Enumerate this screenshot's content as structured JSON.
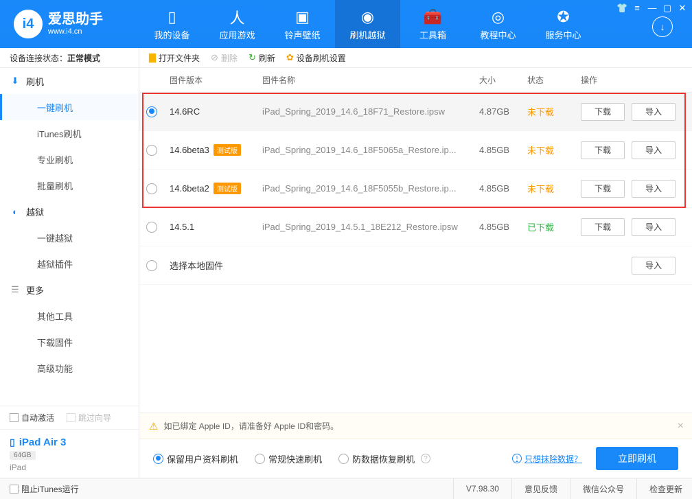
{
  "app": {
    "title": "爱思助手",
    "url": "www.i4.cn"
  },
  "nav": {
    "items": [
      {
        "label": "我的设备"
      },
      {
        "label": "应用游戏"
      },
      {
        "label": "铃声壁纸"
      },
      {
        "label": "刷机越狱"
      },
      {
        "label": "工具箱"
      },
      {
        "label": "教程中心"
      },
      {
        "label": "服务中心"
      }
    ]
  },
  "sidebar": {
    "status_label": "设备连接状态：",
    "status_value": "正常模式",
    "groups": [
      {
        "label": "刷机",
        "items": [
          {
            "label": "一键刷机"
          },
          {
            "label": "iTunes刷机"
          },
          {
            "label": "专业刷机"
          },
          {
            "label": "批量刷机"
          }
        ]
      },
      {
        "label": "越狱",
        "items": [
          {
            "label": "一键越狱"
          },
          {
            "label": "越狱插件"
          }
        ]
      },
      {
        "label": "更多",
        "items": [
          {
            "label": "其他工具"
          },
          {
            "label": "下载固件"
          },
          {
            "label": "高级功能"
          }
        ]
      }
    ],
    "auto_activate": "自动激活",
    "skip_guide": "跳过向导"
  },
  "device": {
    "name": "iPad Air 3",
    "storage": "64GB",
    "type": "iPad"
  },
  "toolbar": {
    "open_folder": "打开文件夹",
    "delete": "删除",
    "refresh": "刷新",
    "settings": "设备刷机设置"
  },
  "table": {
    "headers": {
      "version": "固件版本",
      "name": "固件名称",
      "size": "大小",
      "status": "状态",
      "ops": "操作"
    },
    "status_notdl": "未下载",
    "status_dled": "已下载",
    "beta_tag": "测试版",
    "download_btn": "下载",
    "import_btn": "导入",
    "local_fw": "选择本地固件",
    "rows": [
      {
        "version": "14.6RC",
        "beta": false,
        "name": "iPad_Spring_2019_14.6_18F71_Restore.ipsw",
        "size": "4.87GB",
        "status": "notdl",
        "selected": true
      },
      {
        "version": "14.6beta3",
        "beta": true,
        "name": "iPad_Spring_2019_14.6_18F5065a_Restore.ip...",
        "size": "4.85GB",
        "status": "notdl",
        "selected": false
      },
      {
        "version": "14.6beta2",
        "beta": true,
        "name": "iPad_Spring_2019_14.6_18F5055b_Restore.ip...",
        "size": "4.85GB",
        "status": "notdl",
        "selected": false
      },
      {
        "version": "14.5.1",
        "beta": false,
        "name": "iPad_Spring_2019_14.5.1_18E212_Restore.ipsw",
        "size": "4.85GB",
        "status": "dled",
        "selected": false
      }
    ]
  },
  "notice": "如已绑定 Apple ID，请准备好 Apple ID和密码。",
  "flash_options": {
    "opt1": "保留用户资料刷机",
    "opt2": "常规快速刷机",
    "opt3": "防数据恢复刷机",
    "erase_link": "只想抹除数据？",
    "flash_btn": "立即刷机"
  },
  "statusbar": {
    "block_itunes": "阻止iTunes运行",
    "version": "V7.98.30",
    "feedback": "意见反馈",
    "wechat": "微信公众号",
    "check_update": "检查更新"
  }
}
